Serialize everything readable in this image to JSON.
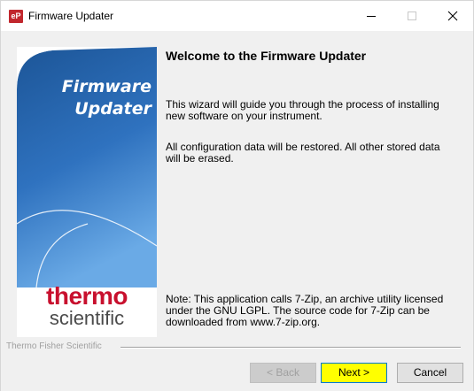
{
  "window": {
    "title": "Firmware Updater",
    "icon_text": "eP",
    "icon_color": "#c1272d"
  },
  "banner": {
    "title_line1": "Firmware",
    "title_line2": "Updater",
    "logo_line1": "thermo",
    "logo_line2": "scientific",
    "gradient_top": "#1f5a9e",
    "gradient_bottom": "#5a9fe0",
    "logo_red": "#c8102e"
  },
  "content": {
    "heading": "Welcome to the Firmware Updater",
    "paragraph1": "This wizard will guide you through the process of installing new software on your instrument.",
    "paragraph2": "All configuration data will be restored.  All other stored data will be erased.",
    "note": "Note: This application calls 7-Zip, an archive utility licensed under the GNU LGPL.  The source code for 7-Zip can be downloaded from www.7-zip.org."
  },
  "footer": {
    "brand": "Thermo Fisher Scientific"
  },
  "buttons": {
    "back": "< Back",
    "next": "Next >",
    "cancel": "Cancel",
    "next_highlight": "#ffff00"
  },
  "titlebar_controls": {
    "minimize": "minimize-icon",
    "maximize": "maximize-icon",
    "close": "close-icon"
  }
}
